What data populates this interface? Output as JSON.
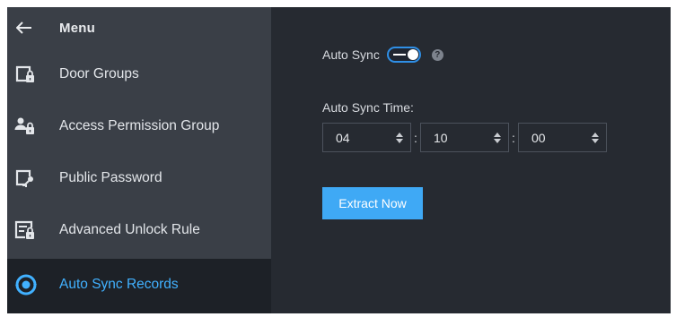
{
  "sidebar": {
    "title": "Menu",
    "items": [
      {
        "label": "Door Groups",
        "icon": "door-group-icon"
      },
      {
        "label": "Access Permission Group",
        "icon": "access-permission-group-icon"
      },
      {
        "label": "Public Password",
        "icon": "public-password-icon"
      },
      {
        "label": "Advanced Unlock Rule",
        "icon": "advanced-unlock-rule-icon"
      },
      {
        "label": "Auto Sync Records",
        "icon": "auto-sync-records-icon",
        "active": true
      }
    ]
  },
  "content": {
    "auto_sync_label": "Auto Sync",
    "auto_sync_enabled": true,
    "help_symbol": "?",
    "sync_time_label": "Auto Sync Time:",
    "time": {
      "hour": "04",
      "minute": "10",
      "second": "00",
      "separator": ":"
    },
    "extract_button_label": "Extract Now"
  },
  "colors": {
    "sidebar_bg": "#3a3f47",
    "content_bg": "#262a31",
    "active_item_bg": "#1d2127",
    "accent": "#41b1ff",
    "button_bg": "#3fa9f5"
  }
}
